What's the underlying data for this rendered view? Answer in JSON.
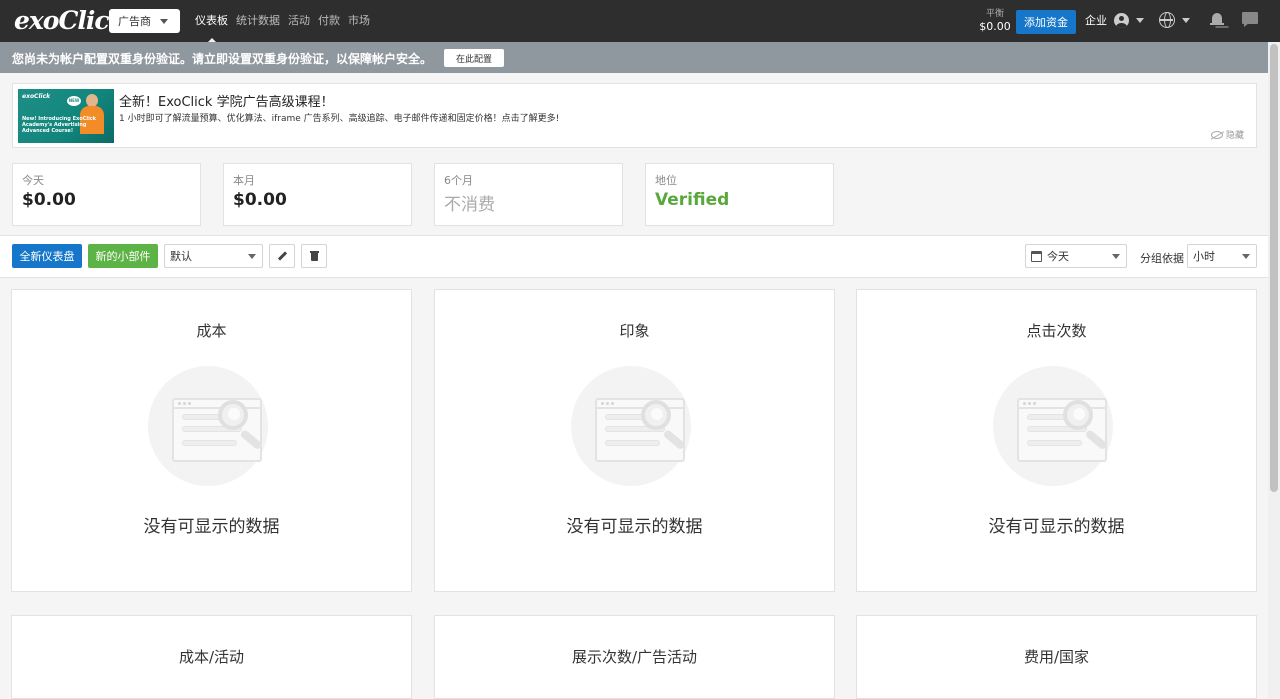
{
  "header": {
    "logo_text": "exoClick",
    "role": "广告商",
    "nav": [
      "仪表板",
      "统计数据",
      "活动",
      "付款",
      "市场"
    ],
    "balance_label": "平衡",
    "balance_value": "$0.00",
    "add_funds": "添加资金",
    "account_label": "企业"
  },
  "banner": {
    "text": "您尚未为帐户配置双重身份验证。请立即设置双重身份验证，以保障帐户安全。",
    "button": "在此配置"
  },
  "promo": {
    "image_logo": "exoClick",
    "image_badge": "NEW",
    "image_text": "New! Introducing ExoClick Academy's Advertising Advanced Course!",
    "title": "全新！ExoClick 学院广告高级课程！",
    "description": "1 小时即可了解流量预算、优化算法、iframe 广告系列、高级追踪、电子邮件传递和固定价格！点击了解更多!",
    "hide": "隐藏"
  },
  "stats": [
    {
      "label": "今天",
      "value": "$0.00",
      "style": "normal"
    },
    {
      "label": "本月",
      "value": "$0.00",
      "style": "normal"
    },
    {
      "label": "6个月",
      "value": "不消费",
      "style": "muted"
    },
    {
      "label": "地位",
      "value": "Verified",
      "style": "ok"
    }
  ],
  "toolbar": {
    "new_dashboard": "全新仪表盘",
    "new_widget": "新的小部件",
    "dashboard_select": "默认",
    "date_select": "今天",
    "group_by_label": "分组依据",
    "group_by_select": "小时"
  },
  "widgets": [
    {
      "title": "成本",
      "empty": "没有可显示的数据"
    },
    {
      "title": "印象",
      "empty": "没有可显示的数据"
    },
    {
      "title": "点击次数",
      "empty": "没有可显示的数据"
    },
    {
      "title": "成本/活动"
    },
    {
      "title": "展示次数/广告活动"
    },
    {
      "title": "费用/国家"
    }
  ],
  "colors": {
    "topbar": "#2e2e2e",
    "primary": "#1676c9",
    "success": "#5db346",
    "verified": "#5aa83c",
    "banner": "#8f979f"
  }
}
